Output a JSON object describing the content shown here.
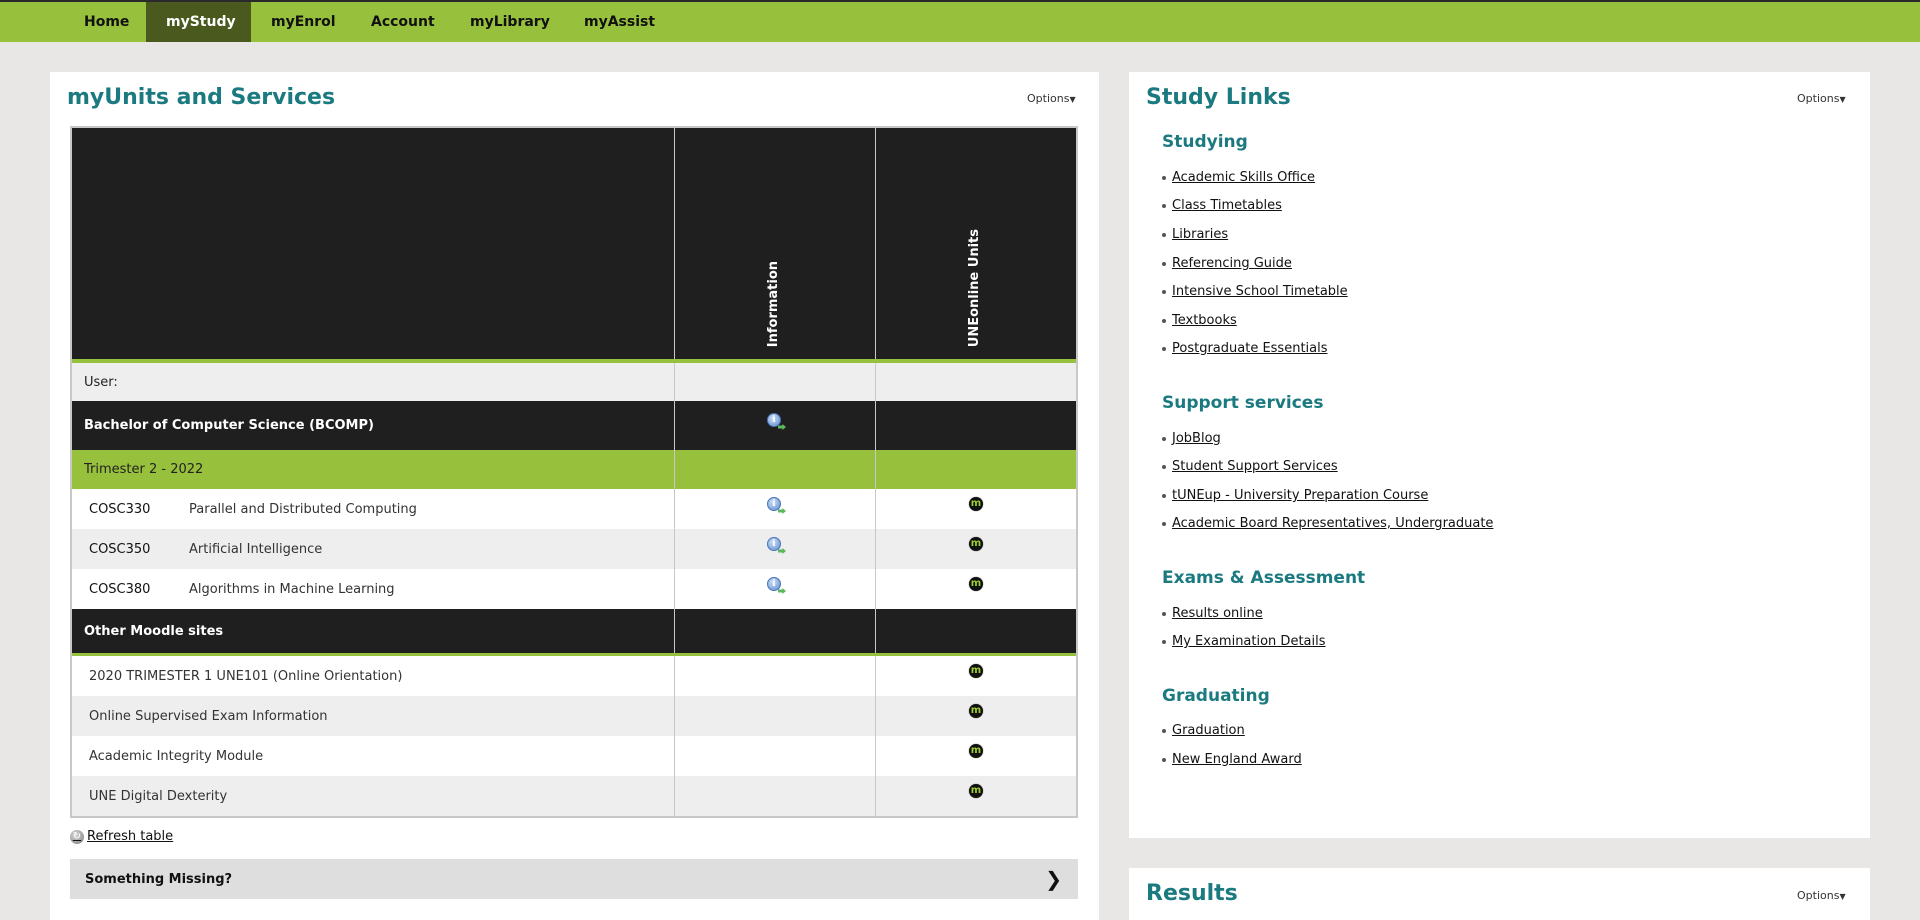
{
  "nav": {
    "items": [
      {
        "label": "Home",
        "active": false
      },
      {
        "label": "myStudy",
        "active": true
      },
      {
        "label": "myEnrol",
        "active": false
      },
      {
        "label": "Account",
        "active": false
      },
      {
        "label": "myLibrary",
        "active": false
      },
      {
        "label": "myAssist",
        "active": false
      }
    ]
  },
  "units_panel": {
    "title": "myUnits and Services",
    "options_label": "Options",
    "columns": [
      "Information",
      "UNEonline Units"
    ],
    "user_label": "User:",
    "course": {
      "name": "Bachelor of Computer Science (BCOMP)",
      "info_icon": "info-icon"
    },
    "term": "Trimester 2 - 2022",
    "units": [
      {
        "code": "COSC330",
        "name": "Parallel and Distributed Computing",
        "info_icon": "info-icon",
        "online_icon": "moodle-icon"
      },
      {
        "code": "COSC350",
        "name": "Artificial Intelligence",
        "info_icon": "info-icon",
        "online_icon": "moodle-icon"
      },
      {
        "code": "COSC380",
        "name": "Algorithms in Machine Learning",
        "info_icon": "info-icon",
        "online_icon": "moodle-icon"
      }
    ],
    "other_sites_label": "Other Moodle sites",
    "other_sites": [
      {
        "name": "2020 TRIMESTER 1 UNE101 (Online Orientation)",
        "online_icon": "moodle-icon"
      },
      {
        "name": "Online Supervised Exam Information",
        "online_icon": "moodle-icon"
      },
      {
        "name": "Academic Integrity Module",
        "online_icon": "moodle-icon"
      },
      {
        "name": "UNE Digital Dexterity",
        "online_icon": "moodle-icon"
      }
    ],
    "refresh_label": " Refresh table",
    "something_missing_label": "Something Missing?",
    "info_glyph": "i",
    "moodle_glyph": "m",
    "chevron_glyph": "❯",
    "refresh_glyph": "↻"
  },
  "study_links": {
    "title": "Study Links",
    "options_label": "Options",
    "sections": [
      {
        "title": "Studying",
        "links": [
          "Academic Skills Office",
          "Class Timetables",
          "Libraries",
          "Referencing Guide",
          "Intensive School Timetable",
          "Textbooks",
          "Postgraduate Essentials"
        ]
      },
      {
        "title": "Support services",
        "links": [
          "JobBlog",
          "Student Support Services",
          "tUNEup - University Preparation Course",
          "Academic Board Representatives, Undergraduate"
        ]
      },
      {
        "title": "Exams & Assessment",
        "links": [
          "Results online",
          "My Examination Details"
        ]
      },
      {
        "title": "Graduating",
        "links": [
          "Graduation",
          "New England Award"
        ]
      }
    ]
  },
  "results_panel": {
    "title": "Results",
    "options_label": "Options"
  },
  "colors": {
    "nav_green": "#97c03d",
    "nav_active": "#4a5a1e",
    "title_teal": "#1a7a80",
    "table_dark": "#1f1f1f"
  }
}
